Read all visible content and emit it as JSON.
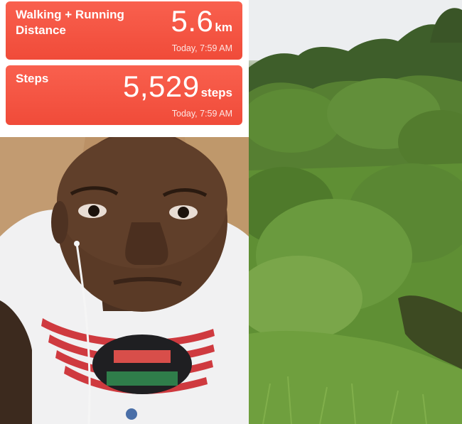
{
  "cards": [
    {
      "title": "Walking + Running\nDistance",
      "value": "5.6",
      "unit": "km",
      "time": "Today, 7:59 AM"
    },
    {
      "title": "Steps",
      "value": "5,529",
      "unit": "steps",
      "time": "Today, 7:59 AM"
    }
  ],
  "colors": {
    "card_red": "#f04b39",
    "card_text": "#ffffff"
  }
}
